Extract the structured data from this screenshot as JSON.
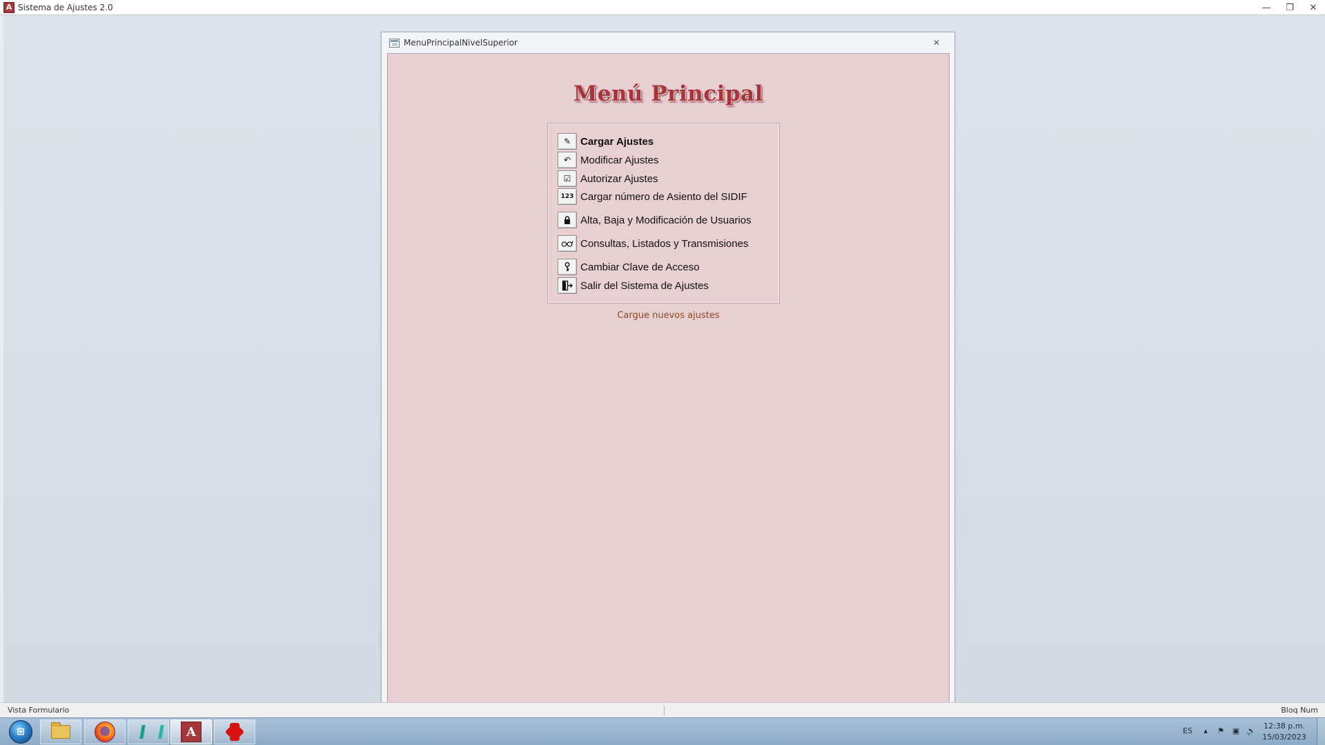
{
  "app": {
    "title": "Sistema de Ajustes 2.0",
    "icon": "access-icon"
  },
  "window_controls": {
    "minimize": "▭",
    "restore": "🗗",
    "close": "✕"
  },
  "form": {
    "title": "MenuPrincipalNivelSuperior",
    "close": "✕"
  },
  "menu": {
    "heading": "Menú Principal",
    "items": [
      {
        "label": "Cargar Ajustes",
        "icon": "edit-form-icon",
        "glyph": "✎",
        "bold": true
      },
      {
        "label": "Modificar Ajustes",
        "icon": "undo-edit-icon",
        "glyph": "↶"
      },
      {
        "label": "Autorizar Ajustes",
        "icon": "checkbox-icon",
        "glyph": "☑"
      },
      {
        "label": "Cargar número de Asiento del SIDIF",
        "icon": "numbers-icon",
        "glyph": "№"
      },
      {
        "label": "Alta, Baja y Modificación de Usuarios",
        "icon": "lock-icon",
        "glyph": "🔒"
      },
      {
        "label": "Consultas, Listados y Transmisiones",
        "icon": "glasses-icon",
        "glyph": "∞"
      },
      {
        "label": "Cambiar Clave de Acceso",
        "icon": "key-icon",
        "glyph": "♀"
      },
      {
        "label": "Salir del Sistema de Ajustes",
        "icon": "exit-door-icon",
        "glyph": "⇥"
      }
    ],
    "hint": "Cargue nuevos ajustes"
  },
  "statusbar": {
    "left": "Vista Formulario",
    "right": "Bloq Num"
  },
  "taskbar": {
    "apps": [
      {
        "name": "file-explorer-icon"
      },
      {
        "name": "firefox-icon"
      },
      {
        "name": "visual-studio-icon"
      },
      {
        "name": "access-icon"
      },
      {
        "name": "red-splat-icon"
      }
    ],
    "language": "ES",
    "time": "12:38 p.m.",
    "date": "15/03/2023"
  },
  "colors": {
    "form_background": "#e8cfd2",
    "heading": "#a8343b",
    "hint": "#8a4a22"
  }
}
